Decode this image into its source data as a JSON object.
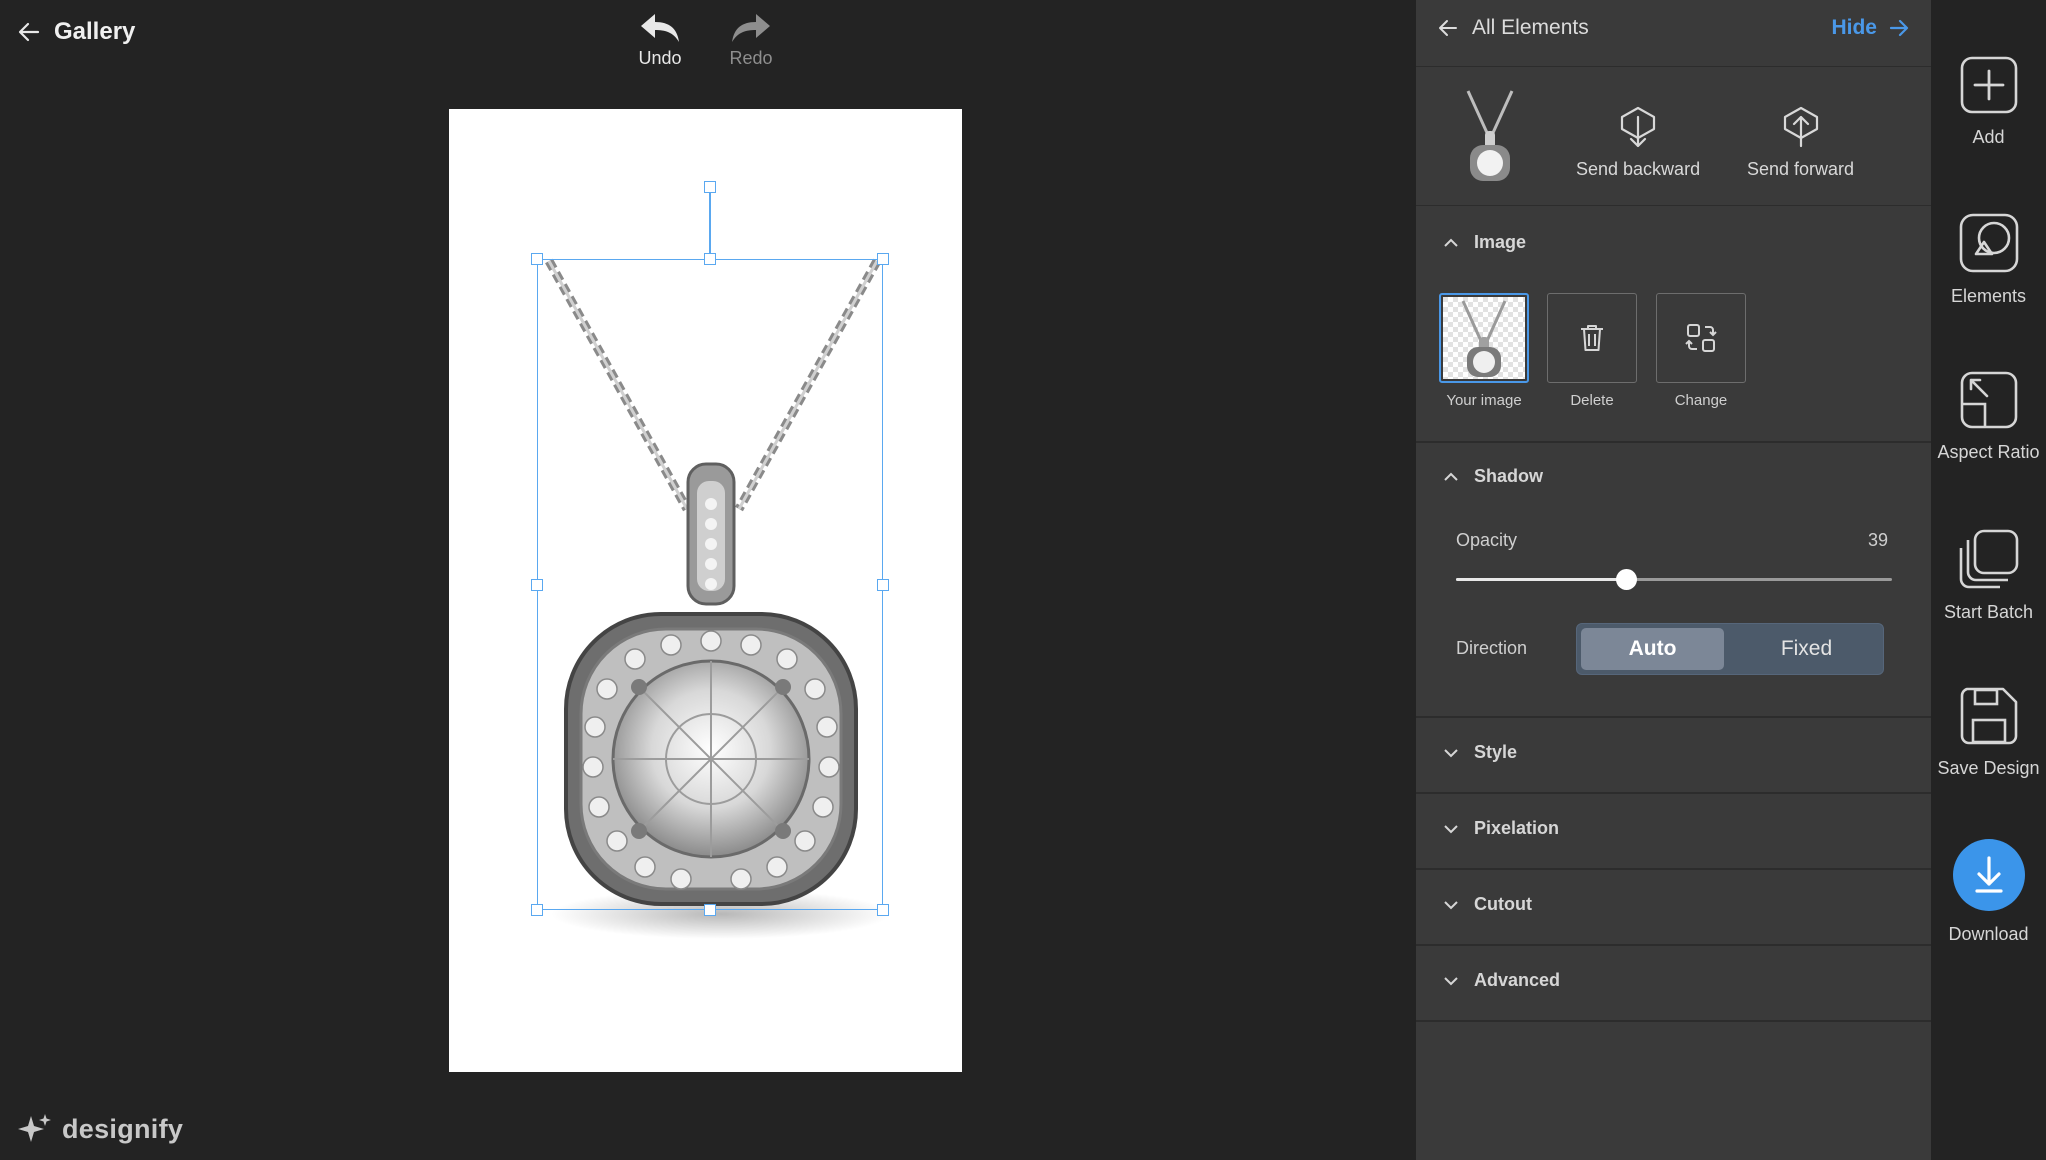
{
  "header": {
    "back_label": "Gallery",
    "undo_label": "Undo",
    "redo_label": "Redo"
  },
  "brand": {
    "name": "designify"
  },
  "panel": {
    "title": "All Elements",
    "hide_label": "Hide",
    "tools": {
      "send_backward": "Send backward",
      "send_forward": "Send forward"
    },
    "image_section": {
      "title": "Image",
      "tiles": {
        "your_image": "Your image",
        "delete": "Delete",
        "change": "Change"
      }
    },
    "shadow_section": {
      "title": "Shadow",
      "opacity_label": "Opacity",
      "opacity_value": "39",
      "direction_label": "Direction",
      "direction_options": {
        "auto": "Auto",
        "fixed": "Fixed"
      },
      "direction_selected": "Auto"
    },
    "collapsed_sections": {
      "style": "Style",
      "pixelation": "Pixelation",
      "cutout": "Cutout",
      "advanced": "Advanced"
    }
  },
  "rail": {
    "add": "Add",
    "elements": "Elements",
    "aspect_ratio": "Aspect Ratio",
    "start_batch": "Start Batch",
    "save_design": "Save Design",
    "download": "Download"
  },
  "colors": {
    "accent": "#4a98e8",
    "selection": "#5aa8f0",
    "panel_bg": "#3a3a3a",
    "app_bg": "#232323"
  },
  "canvas": {
    "image_subject": "diamond halo pendant necklace"
  }
}
